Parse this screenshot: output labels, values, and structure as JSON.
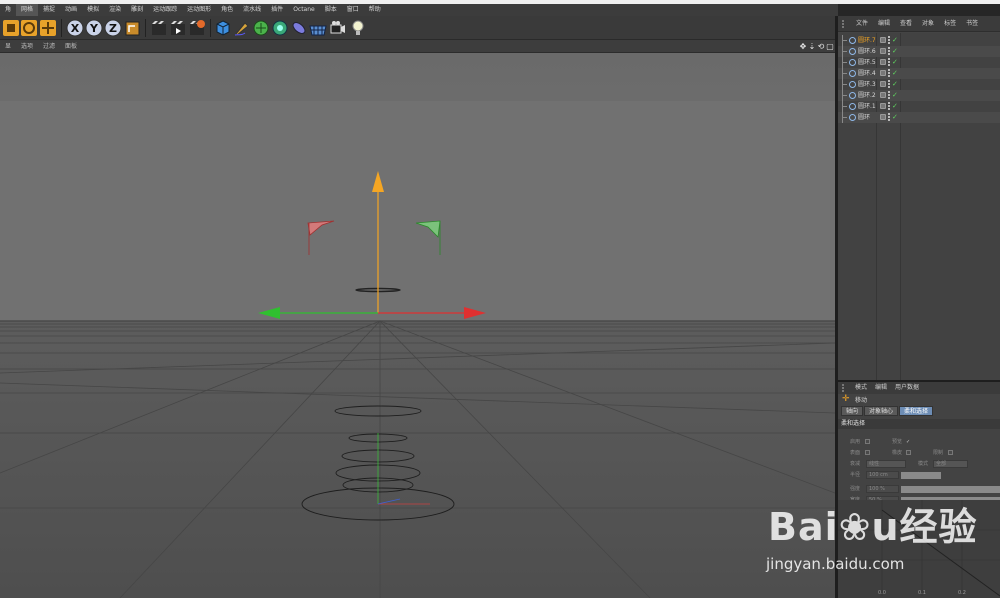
{
  "menubar": {
    "items": [
      "角",
      "网格",
      "捕捉",
      "动画",
      "模拟",
      "渲染",
      "雕刻",
      "运动跟踪",
      "运动图形",
      "角色",
      "流水线",
      "插件",
      "Octane",
      "脚本",
      "窗口",
      "帮助"
    ],
    "active_index": 1
  },
  "toolbar": {
    "axis_x": "X",
    "axis_y": "Y",
    "axis_z": "Z"
  },
  "viewport_header": {
    "items": [
      "显",
      "选项",
      "过滤",
      "面板"
    ],
    "nav_icons": [
      "✥",
      "⇣",
      "⟲",
      "▢"
    ]
  },
  "object_manager": {
    "tabs": [
      "文件",
      "编辑",
      "查看",
      "对象",
      "标签",
      "书签"
    ],
    "objects": [
      {
        "name": "圆环.7",
        "selected": true
      },
      {
        "name": "圆环.6",
        "selected": false
      },
      {
        "name": "圆环.5",
        "selected": false
      },
      {
        "name": "圆环.4",
        "selected": false
      },
      {
        "name": "圆环.3",
        "selected": false
      },
      {
        "name": "圆环.2",
        "selected": false
      },
      {
        "name": "圆环.1",
        "selected": false
      },
      {
        "name": "圆环",
        "selected": false
      }
    ],
    "check_glyph": "✓"
  },
  "attributes": {
    "tabs": [
      "模式",
      "编辑",
      "用户数据"
    ],
    "tool_icon": "✛",
    "tool_name": "移动",
    "subtabs": [
      "轴向",
      "对象轴心",
      "柔和选择"
    ],
    "active_subtab": 2,
    "section_title": "柔和选择",
    "fields": {
      "enable_label": "启用",
      "preview_label": "预览",
      "preview_check": "✓",
      "surface_label": "表面",
      "rubber_label": "橡皮",
      "limit_label": "限制",
      "mode_label": "衰减",
      "mode_value": "线性",
      "mode2_label": "模式",
      "mode2_value": "全部",
      "radius_label": "半径",
      "radius_value": "100 cm",
      "strength_label": "强度",
      "strength_value": "100 %",
      "width_label": "宽度",
      "width_value": "50 %"
    },
    "graph_ticks": [
      "0.0",
      "0.1",
      "0.2"
    ]
  },
  "watermark": {
    "logo": "Bai❀u经验",
    "url": "jingyan.baidu.com"
  },
  "colors": {
    "axis_y": "#f5a623",
    "axis_x": "#e03030",
    "axis_z": "#2fc02f",
    "selection": "#f5a623",
    "viewport_bg_top": "#6a6a6a",
    "viewport_bg_bottom": "#585858"
  }
}
